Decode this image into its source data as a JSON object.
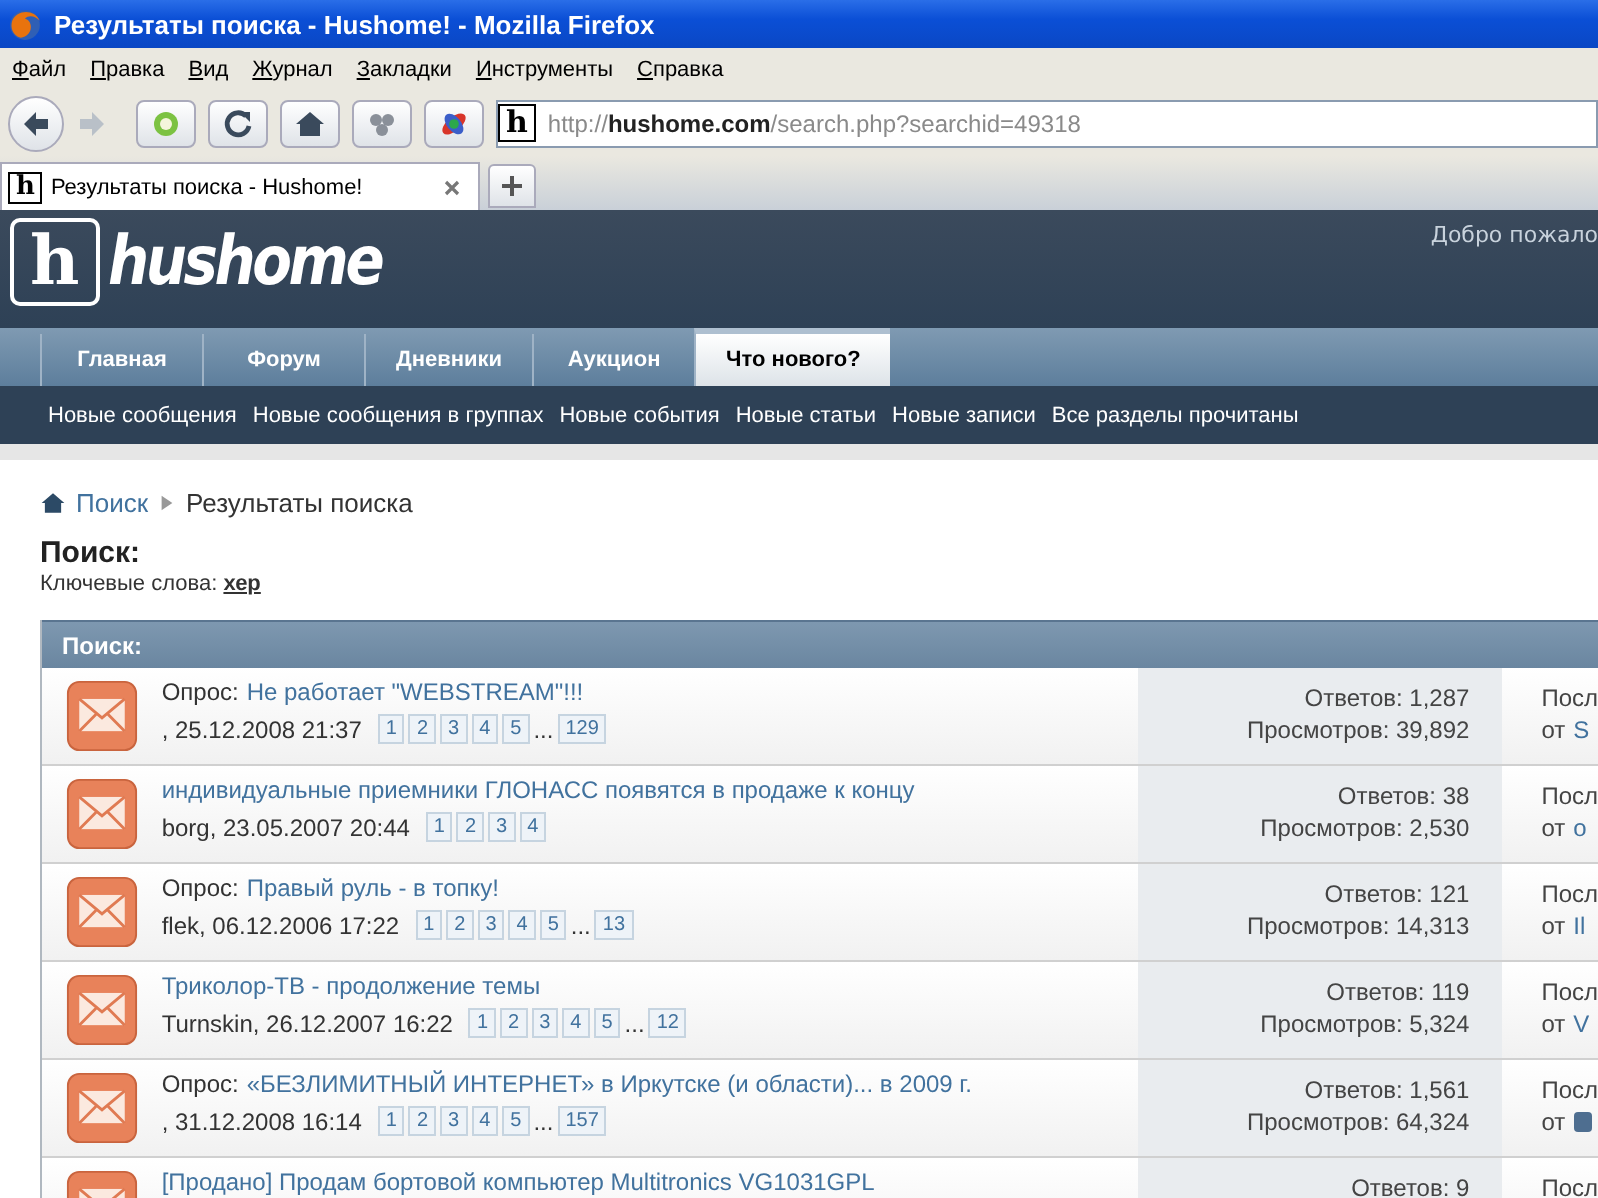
{
  "window": {
    "title": "Результаты поиска - Hushome! - Mozilla Firefox"
  },
  "menu": [
    "Файл",
    "Правка",
    "Вид",
    "Журнал",
    "Закладки",
    "Инструменты",
    "Справка"
  ],
  "address_bar": {
    "favicon": "h",
    "value": "http://**hushome.com**/search.php?searchid=49318"
  },
  "browser_tabs": [
    {
      "favicon": "h",
      "label": "Результаты поиска - Hushome!",
      "selected": true
    }
  ],
  "site": {
    "logo_letter": "h",
    "logo_text": "hushome",
    "welcome": "Добро пожало",
    "nav_tabs": [
      {
        "label": "Главная",
        "selected": false
      },
      {
        "label": "Форум",
        "selected": false
      },
      {
        "label": "Дневники",
        "selected": false
      },
      {
        "label": "Аукцион",
        "selected": false
      },
      {
        "label": "Что нового?",
        "selected": true
      }
    ],
    "sub_nav": [
      "Новые сообщения",
      "Новые сообщения в группах",
      "Новые события",
      "Новые статьи",
      "Новые записи",
      "Все разделы прочитаны"
    ]
  },
  "breadcrumb": [
    "Поиск",
    "Результаты поиска"
  ],
  "heading": "Поиск:",
  "keywords": "Ключевые слова: **хер**",
  "results": {
    "title": "Поиск:",
    "rows": [
      {
        "prefix": "Опрос:",
        "title": "Не работает \"WEBSTREAM\"!!!",
        "meta": ", 25.12.2008 21:37",
        "pages": [
          "1",
          "2",
          "3",
          "4",
          "5"
        ],
        "ellipsis": "...",
        "last_page": "129",
        "replies": "Ответов: 1,287",
        "views": "Просмотров: 39,892",
        "last_1": "Посл",
        "last_2": "от",
        "last_user": "S"
      },
      {
        "title": "индивидуальные приемники ГЛОНАСС появятся в продаже к концу",
        "meta": "borg, 23.05.2007 20:44",
        "pages": [
          "1",
          "2",
          "3",
          "4"
        ],
        "replies": "Ответов: 38",
        "views": "Просмотров: 2,530",
        "last_1": "Посл",
        "last_2": "от",
        "last_user": "о"
      },
      {
        "prefix": "Опрос:",
        "title": "Правый руль - в топку!",
        "meta": "flek, 06.12.2006 17:22",
        "pages": [
          "1",
          "2",
          "3",
          "4",
          "5"
        ],
        "ellipsis": "...",
        "last_page": "13",
        "replies": "Ответов: 121",
        "views": "Просмотров: 14,313",
        "last_1": "Посл",
        "last_2": "от",
        "last_user": "Il"
      },
      {
        "title": "Триколор-ТВ - продолжение темы",
        "meta": "Turnskin, 26.12.2007 16:22",
        "pages": [
          "1",
          "2",
          "3",
          "4",
          "5"
        ],
        "ellipsis": "...",
        "last_page": "12",
        "replies": "Ответов: 119",
        "views": "Просмотров: 5,324",
        "last_1": "Посл",
        "last_2": "от",
        "last_user": "V"
      },
      {
        "prefix": "Опрос:",
        "title": "«БЕЗЛИМИТНЫЙ ИНТЕРНЕТ» в Иркутске (и области)... в 2009 г.",
        "meta": ", 31.12.2008 16:14",
        "pages": [
          "1",
          "2",
          "3",
          "4",
          "5"
        ],
        "ellipsis": "...",
        "last_page": "157",
        "replies": "Ответов: 1,561",
        "views": "Просмотров: 64,324",
        "last_1": "Посл",
        "last_2": "от"
      },
      {
        "title": "[Продано] Продам бортовой компьютер Multitronics VG1031GPL",
        "replies": "Ответов: 9",
        "last_1": "Посл"
      }
    ]
  }
}
